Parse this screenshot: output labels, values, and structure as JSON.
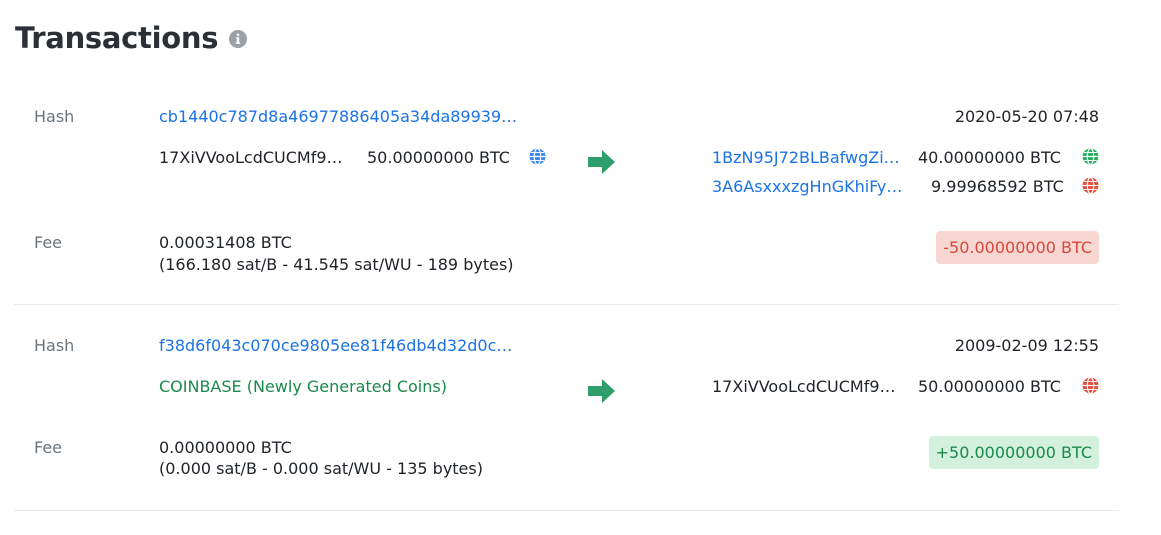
{
  "page": {
    "title": "Transactions",
    "info_icon": "info-circle-icon"
  },
  "labels": {
    "hash": "Hash",
    "fee": "Fee"
  },
  "colors": {
    "link": "#1a73e8",
    "positive": "#1a8a4a",
    "negative": "#d9473c",
    "arrow": "#2e9e6b",
    "globe_spent": "#27ae60",
    "globe_unspent": "#e74c3c",
    "globe_input": "#3b86f7"
  },
  "transactions": [
    {
      "hash": "cb1440c787d8a46977886405a34da89939…",
      "timestamp": "2020-05-20 07:48",
      "inputs": [
        {
          "address": "17XiVVooLcdCUCMf9…",
          "amount": "50.00000000 BTC",
          "icon": "globe-icon"
        }
      ],
      "outputs": [
        {
          "address": "1BzN95J72BLBafwgZi…",
          "amount": "40.00000000 BTC",
          "icon": "globe-icon",
          "status": "green"
        },
        {
          "address": "3A6AsxxxzgHnGKhiFy…",
          "amount": "9.99968592 BTC",
          "icon": "globe-icon",
          "status": "red"
        }
      ],
      "fee": "0.00031408 BTC",
      "fee_detail": "(166.180 sat/B - 41.545 sat/WU - 189 bytes)",
      "balance_change": "-50.00000000 BTC"
    },
    {
      "hash": "f38d6f043c070ce9805ee81f46db4d32d0c…",
      "timestamp": "2009-02-09 12:55",
      "inputs": [
        {
          "address": "COINBASE (Newly Generated Coins)"
        }
      ],
      "outputs": [
        {
          "address": "17XiVVooLcdCUCMf9…",
          "amount": "50.00000000 BTC",
          "icon": "globe-icon",
          "status": "red"
        }
      ],
      "fee": "0.00000000 BTC",
      "fee_detail": "(0.000 sat/B - 0.000 sat/WU - 135 bytes)",
      "balance_change": "+50.00000000 BTC"
    }
  ]
}
